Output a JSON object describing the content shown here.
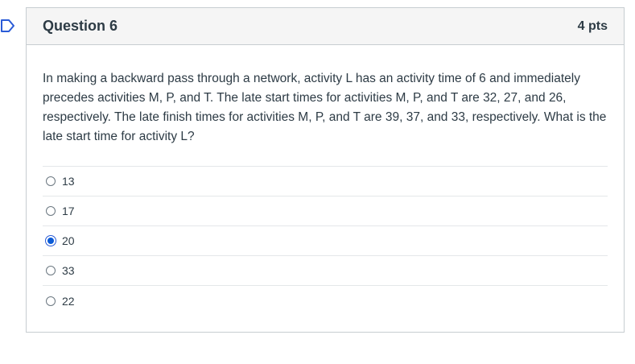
{
  "question": {
    "title": "Question 6",
    "points": "4 pts",
    "text": "In making a backward pass through a network, activity L has an activity time of 6 and immediately precedes activities M, P, and T. The late start times for activities M, P, and T are 32, 27, and 26, respectively. The late finish times for activities M, P, and T are 39, 37, and 33, respectively. What is the late start time for activity L?",
    "answers": [
      {
        "label": "13",
        "selected": false
      },
      {
        "label": "17",
        "selected": false
      },
      {
        "label": "20",
        "selected": true
      },
      {
        "label": "33",
        "selected": false
      },
      {
        "label": "22",
        "selected": false
      }
    ]
  },
  "colors": {
    "accent": "#0b5bd6",
    "header_bg": "#f5f5f5",
    "border": "#c7cdd1",
    "flag": "#2a5bd7"
  },
  "icons": {
    "flag": "bookmark-flag-icon"
  }
}
